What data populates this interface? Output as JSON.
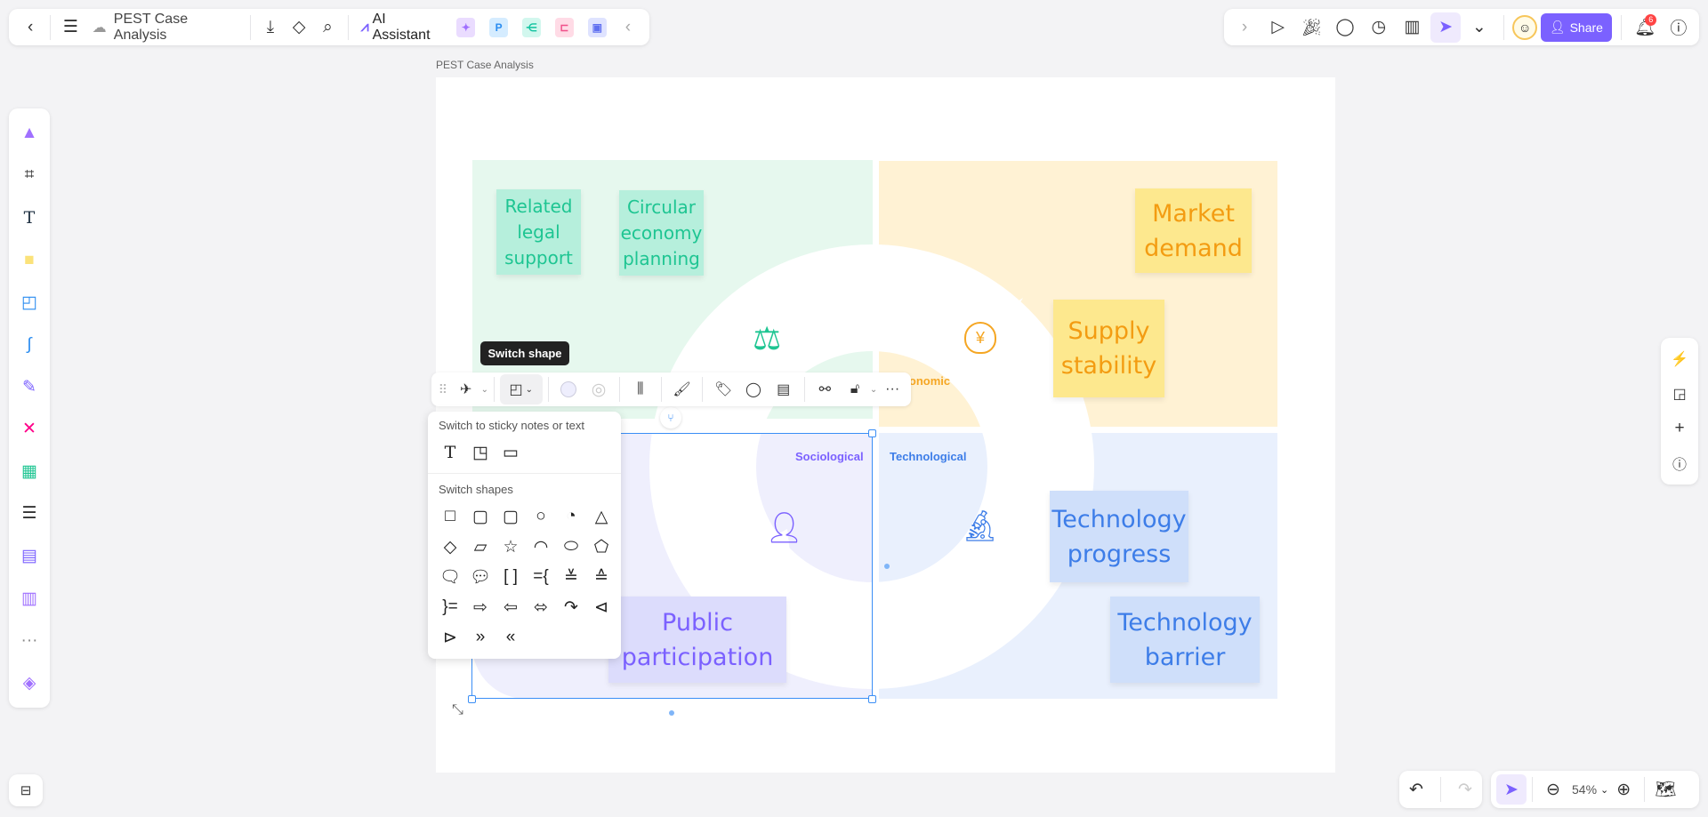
{
  "header": {
    "title": "PEST Case Analysis",
    "ai_assistant": "AI Assistant",
    "share": "Share",
    "notifications": "6"
  },
  "canvas": {
    "frame_label": "PEST Case Analysis",
    "zoom": "54%"
  },
  "quadrants": {
    "political": {
      "color": "#e6f8ee",
      "notes": [
        "Related legal support",
        "Circular economy planning"
      ],
      "note_bg": "#b6efdc",
      "text_color": "#1ec592"
    },
    "economic": {
      "label": "Economic",
      "color": "#fff2d4",
      "notes": [
        "Market demand",
        "Supply stability"
      ],
      "note_bg": "#fde88e",
      "text_color": "#f39c12"
    },
    "sociological": {
      "label": "Sociological",
      "color": "#efeffd",
      "notes": [
        "Public participation"
      ],
      "note_bg": "#dcdcfc",
      "text_color": "#7b61ff"
    },
    "technological": {
      "label": "Technological",
      "color": "#e9f0fd",
      "notes": [
        "Technology progress",
        "Technology barrier"
      ],
      "note_bg": "#cfdffa",
      "text_color": "#3d7de8"
    }
  },
  "toolbar": {
    "tooltip": "Switch shape"
  },
  "shape_panel": {
    "section1": "Switch to sticky notes or text",
    "section2": "Switch shapes",
    "shapes": [
      "square",
      "rounded-square",
      "rounded-corner",
      "circle",
      "pie",
      "triangle",
      "diamond",
      "parallelogram",
      "star",
      "semicircle",
      "pill",
      "pentagon",
      "callout-rect",
      "callout-round",
      "brackets",
      "brace-left",
      "bar-up",
      "bar-down",
      "brace-right",
      "arrow-right",
      "arrow-left",
      "arrow-both",
      "arrow-curve",
      "tag-left",
      "tag-right",
      "chevron",
      "chevron-left"
    ]
  },
  "colors": {
    "accent": "#7b61ff",
    "selection": "#3a8ef6"
  }
}
